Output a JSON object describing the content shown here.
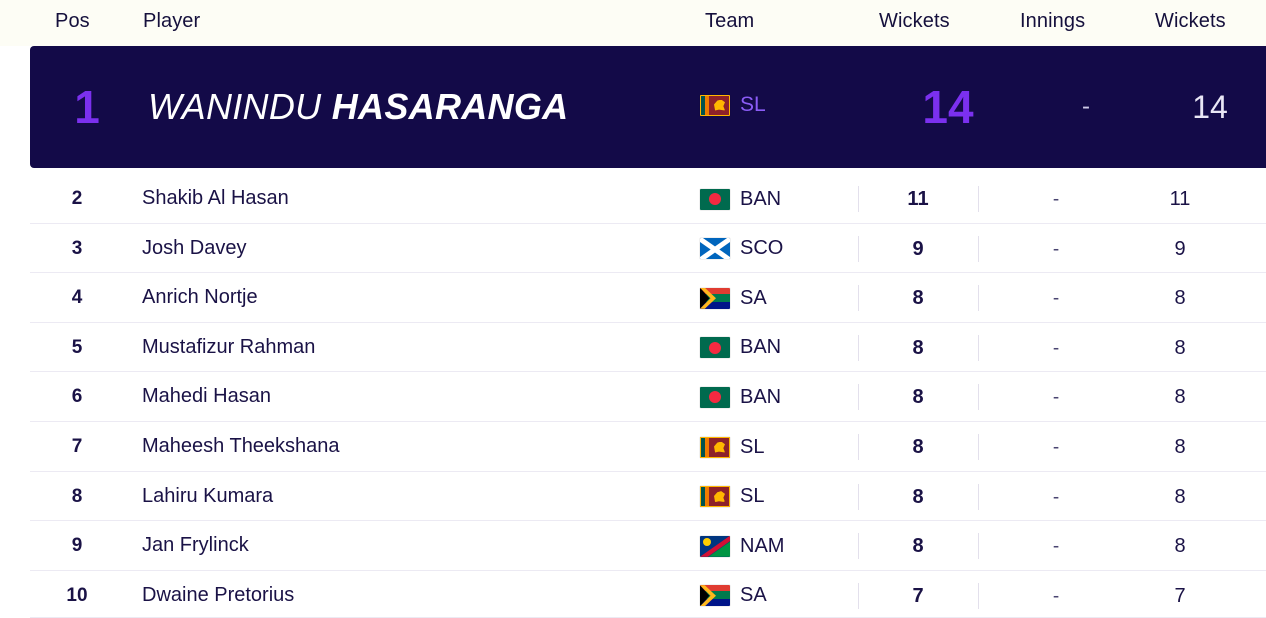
{
  "table": {
    "headers": {
      "pos": "Pos",
      "player": "Player",
      "team": "Team",
      "wickets": "Wickets",
      "innings": "Innings",
      "wickets2": "Wickets"
    },
    "highlight": {
      "pos": "1",
      "first_name": "WANINDU",
      "last_name": "HASARANGA",
      "team": "SL",
      "team_flag": "flag-sri-lanka",
      "wickets": "14",
      "innings": "-",
      "wickets2": "14"
    },
    "rows": [
      {
        "pos": "2",
        "player": "Shakib Al Hasan",
        "team": "BAN",
        "flag": "flag-bangladesh",
        "wickets": "11",
        "innings": "-",
        "wickets2": "11"
      },
      {
        "pos": "3",
        "player": "Josh Davey",
        "team": "SCO",
        "flag": "flag-scotland",
        "wickets": "9",
        "innings": "-",
        "wickets2": "9"
      },
      {
        "pos": "4",
        "player": "Anrich Nortje",
        "team": "SA",
        "flag": "flag-south-africa",
        "wickets": "8",
        "innings": "-",
        "wickets2": "8"
      },
      {
        "pos": "5",
        "player": "Mustafizur Rahman",
        "team": "BAN",
        "flag": "flag-bangladesh",
        "wickets": "8",
        "innings": "-",
        "wickets2": "8"
      },
      {
        "pos": "6",
        "player": "Mahedi Hasan",
        "team": "BAN",
        "flag": "flag-bangladesh",
        "wickets": "8",
        "innings": "-",
        "wickets2": "8"
      },
      {
        "pos": "7",
        "player": "Maheesh Theekshana",
        "team": "SL",
        "flag": "flag-sri-lanka",
        "wickets": "8",
        "innings": "-",
        "wickets2": "8"
      },
      {
        "pos": "8",
        "player": "Lahiru Kumara",
        "team": "SL",
        "flag": "flag-sri-lanka",
        "wickets": "8",
        "innings": "-",
        "wickets2": "8"
      },
      {
        "pos": "9",
        "player": "Jan Frylinck",
        "team": "NAM",
        "flag": "flag-namibia",
        "wickets": "8",
        "innings": "-",
        "wickets2": "8"
      },
      {
        "pos": "10",
        "player": "Dwaine Pretorius",
        "team": "SA",
        "flag": "flag-south-africa",
        "wickets": "7",
        "innings": "-",
        "wickets2": "7"
      }
    ]
  },
  "colors": {
    "highlight_bg": "#130a48",
    "accent_purple": "#7b30ef",
    "team_purple": "#8b5cf6",
    "text_dark": "#1a1246",
    "page_bg": "#fdfdf5"
  }
}
